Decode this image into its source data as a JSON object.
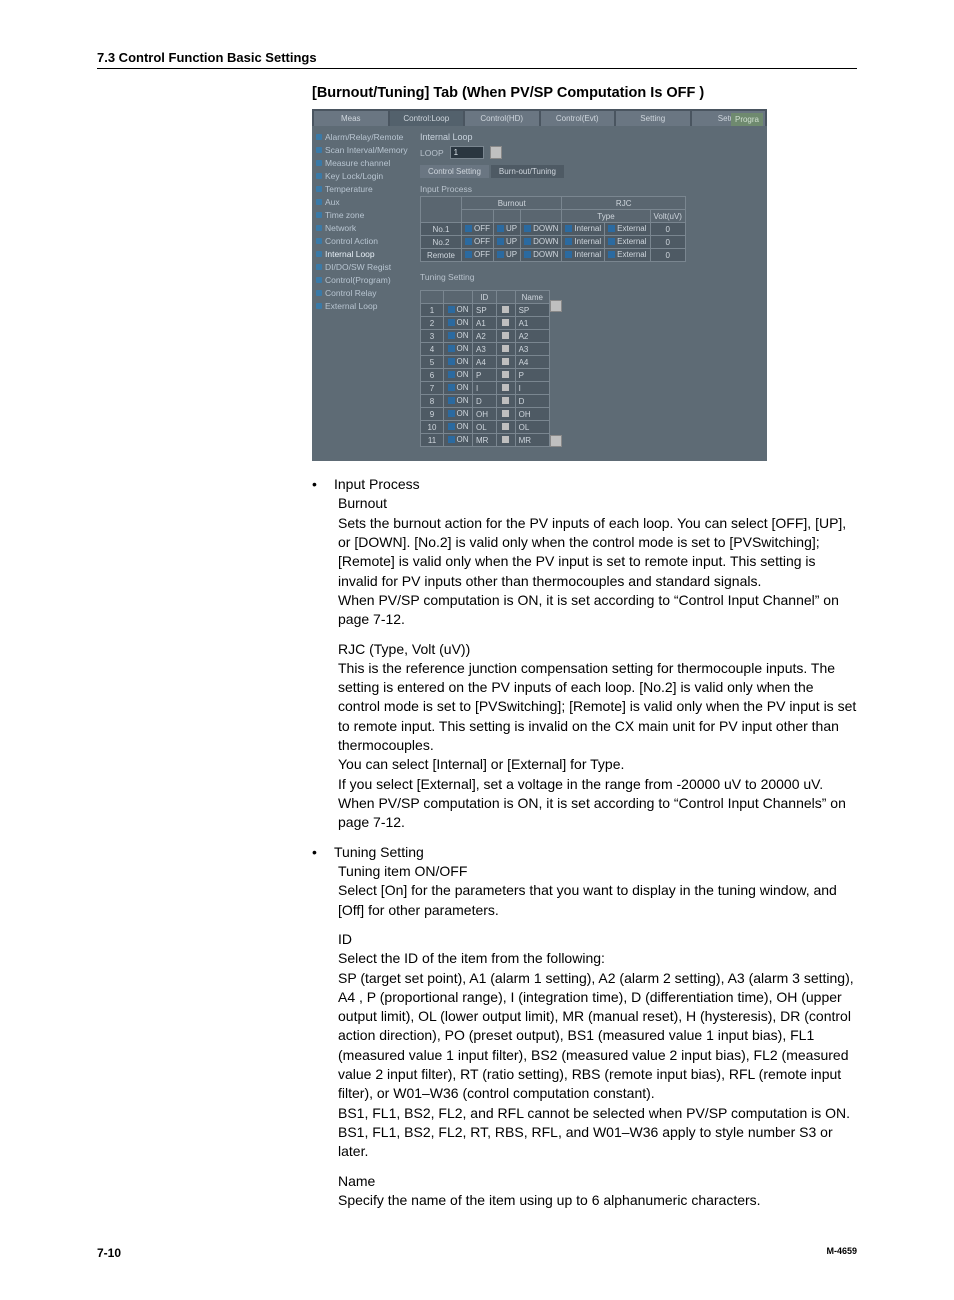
{
  "header": {
    "section": "7.3  Control Function Basic Settings"
  },
  "tab_title": "[Burnout/Tuning] Tab (When PV/SP Computation Is OFF )",
  "screenshot": {
    "top_tabs": [
      "Meas",
      "Control:Loop",
      "Control(HD)",
      "Control(Evt)",
      "Setting",
      "Setup"
    ],
    "progra": "Progra",
    "sidebar": [
      "Alarm/Relay/Remote",
      "Scan Interval/Memory",
      "Measure channel",
      "Key Lock/Login",
      "Temperature",
      "Aux",
      "Time zone",
      "Network",
      "Control Action",
      "Internal Loop",
      "DI/DO/SW Regist",
      "Control(Program)",
      "Control Relay",
      "External Loop"
    ],
    "sidebar_active_index": 9,
    "internal_loop_label": "Internal Loop",
    "loop_label": "LOOP",
    "loop_value": "1",
    "subtabs": [
      "Control Setting",
      "Burn-out/Tuning"
    ],
    "subtab_active": 1,
    "input_process_label": "Input Process",
    "burnout_header": "Burnout",
    "rjc_header": "RJC",
    "rjc_sub_type": "Type",
    "rjc_sub_volt": "Volt(uV)",
    "burnout_rows": [
      {
        "name": "No.1",
        "b1": "OFF",
        "b2": "UP",
        "b3": "DOWN",
        "t1": "Internal",
        "t2": "External",
        "v": "0"
      },
      {
        "name": "No.2",
        "b1": "OFF",
        "b2": "UP",
        "b3": "DOWN",
        "t1": "Internal",
        "t2": "External",
        "v": "0"
      },
      {
        "name": "Remote",
        "b1": "OFF",
        "b2": "UP",
        "b3": "DOWN",
        "t1": "Internal",
        "t2": "External",
        "v": "0"
      }
    ],
    "tuning_label": "Tuning Setting",
    "tuning_cols": [
      "",
      "",
      "ID",
      "",
      "Name"
    ],
    "tuning_rows": [
      {
        "n": "1",
        "on": "ON",
        "id": "SP",
        "name": "SP"
      },
      {
        "n": "2",
        "on": "ON",
        "id": "A1",
        "name": "A1"
      },
      {
        "n": "3",
        "on": "ON",
        "id": "A2",
        "name": "A2"
      },
      {
        "n": "4",
        "on": "ON",
        "id": "A3",
        "name": "A3"
      },
      {
        "n": "5",
        "on": "ON",
        "id": "A4",
        "name": "A4"
      },
      {
        "n": "6",
        "on": "ON",
        "id": "P",
        "name": "P"
      },
      {
        "n": "7",
        "on": "ON",
        "id": "I",
        "name": "I"
      },
      {
        "n": "8",
        "on": "ON",
        "id": "D",
        "name": "D"
      },
      {
        "n": "9",
        "on": "ON",
        "id": "OH",
        "name": "OH"
      },
      {
        "n": "10",
        "on": "ON",
        "id": "OL",
        "name": "OL"
      },
      {
        "n": "11",
        "on": "ON",
        "id": "MR",
        "name": "MR"
      }
    ]
  },
  "body": {
    "b1_label": "Input Process",
    "b1_h1": "Burnout",
    "b1_p1": "Sets the burnout action for the PV inputs of each loop. You can select [OFF], [UP], or [DOWN]. [No.2] is valid only when the control mode is set to [PVSwitching]; [Remote] is valid only when the PV input is set to remote input.  This setting is invalid for PV inputs other than thermocouples and standard signals.",
    "b1_p2": "When PV/SP computation is ON, it is set according to “Control Input Channel” on page 7-12.",
    "b1_h2": "RJC (Type, Volt (uV))",
    "b1_p3": "This is the reference junction compensation setting for thermocouple inputs.  The setting is entered on the PV inputs of each loop.  [No.2] is valid only when the control mode is set to [PVSwitching]; [Remote] is valid only when the PV input is set to remote input.  This setting is invalid on the CX main unit for PV input other than thermocouples.",
    "b1_p4": "You can select [Internal] or [External] for Type.",
    "b1_p5": "If you select [External], set a voltage in the range from -20000 uV to 20000 uV.",
    "b1_p6": "When PV/SP computation is ON, it is set according to “Control Input Channels” on page 7-12.",
    "b2_label": "Tuning Setting",
    "b2_h1": "Tuning item ON/OFF",
    "b2_p1": "Select [On] for the parameters that you want to display in the tuning window, and [Off] for other parameters.",
    "b2_h2": "ID",
    "b2_p2": "Select the ID of the item from the following:",
    "b2_p3": "SP (target set point), A1 (alarm 1 setting), A2 (alarm 2 setting), A3 (alarm 3 setting), A4 , P (proportional range), I (integration time), D (differentiation time), OH (upper output limit), OL (lower output limit), MR (manual reset), H (hysteresis), DR (control action direction), PO (preset output), BS1 (measured value 1 input bias), FL1 (measured value 1 input filter), BS2 (measured value 2 input bias), FL2 (measured value 2 input filter), RT (ratio setting), RBS (remote input bias), RFL (remote input filter), or W01–W36 (control computation constant).",
    "b2_p4": "BS1, FL1, BS2, FL2, and RFL cannot be selected when PV/SP computation is ON.",
    "b2_p5": "BS1, FL1, BS2, FL2, RT, RBS, RFL, and W01–W36 apply to style number S3 or later.",
    "b2_h3": "Name",
    "b2_p6": "Specify the name of the item using up to 6 alphanumeric characters."
  },
  "footer": {
    "page": "7-10",
    "doc": "M-4659"
  }
}
